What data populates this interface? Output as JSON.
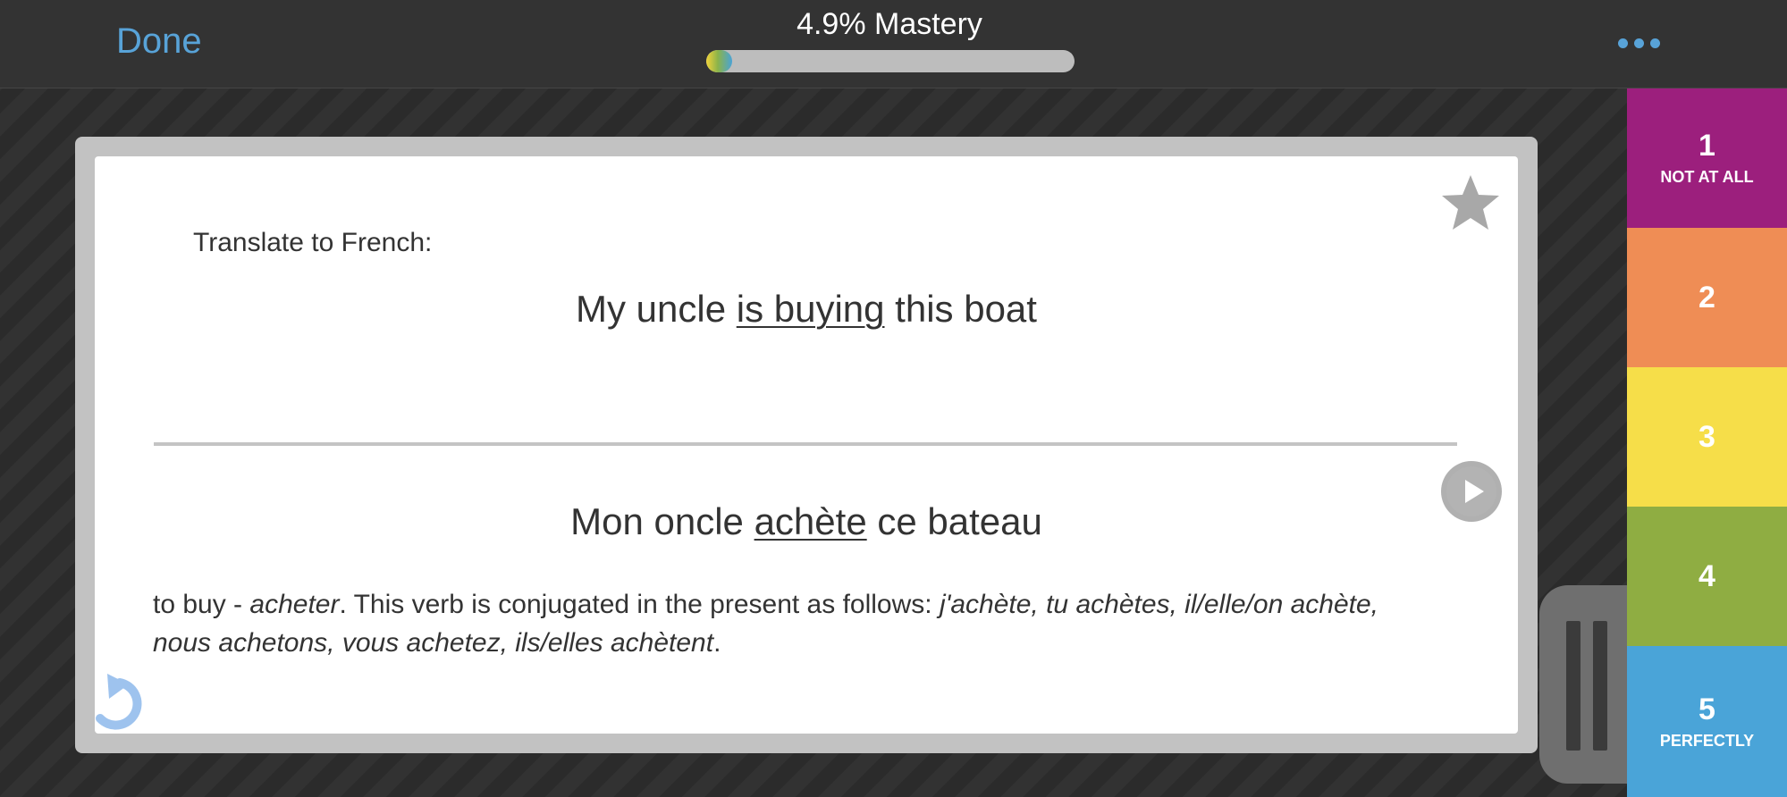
{
  "header": {
    "done_label": "Done",
    "mastery_label": "4.9% Mastery",
    "mastery_progress": 0.049,
    "more_icon": "ellipsis-icon"
  },
  "card": {
    "prompt_label": "Translate to French:",
    "front": {
      "before": "My uncle ",
      "highlight": "is buying",
      "after": " this boat"
    },
    "back": {
      "before": "Mon oncle ",
      "highlight": "achète",
      "after": " ce bateau"
    },
    "note": {
      "lead": "to buy - ",
      "verb": "acheter",
      "middle": ". This verb is conjugated in the present as follows: ",
      "forms": "j'achète, tu achètes, il/elle/on achète, nous achetons, vous achetez, ils/elles achètent",
      "end": "."
    },
    "icons": {
      "star": "star-icon",
      "play": "play-icon",
      "undo": "undo-icon"
    }
  },
  "pause_icon": "pause-icon",
  "ratings": [
    {
      "number": "1",
      "label": "NOT AT ALL",
      "color": "#9c1f7d"
    },
    {
      "number": "2",
      "label": "",
      "color": "#ef8d55"
    },
    {
      "number": "3",
      "label": "",
      "color": "#f6de49"
    },
    {
      "number": "4",
      "label": "",
      "color": "#8fad42"
    },
    {
      "number": "5",
      "label": "PERFECTLY",
      "color": "#4aa4d8"
    }
  ],
  "colors": {
    "accent": "#58a3d8",
    "background": "#2e2e2e"
  }
}
